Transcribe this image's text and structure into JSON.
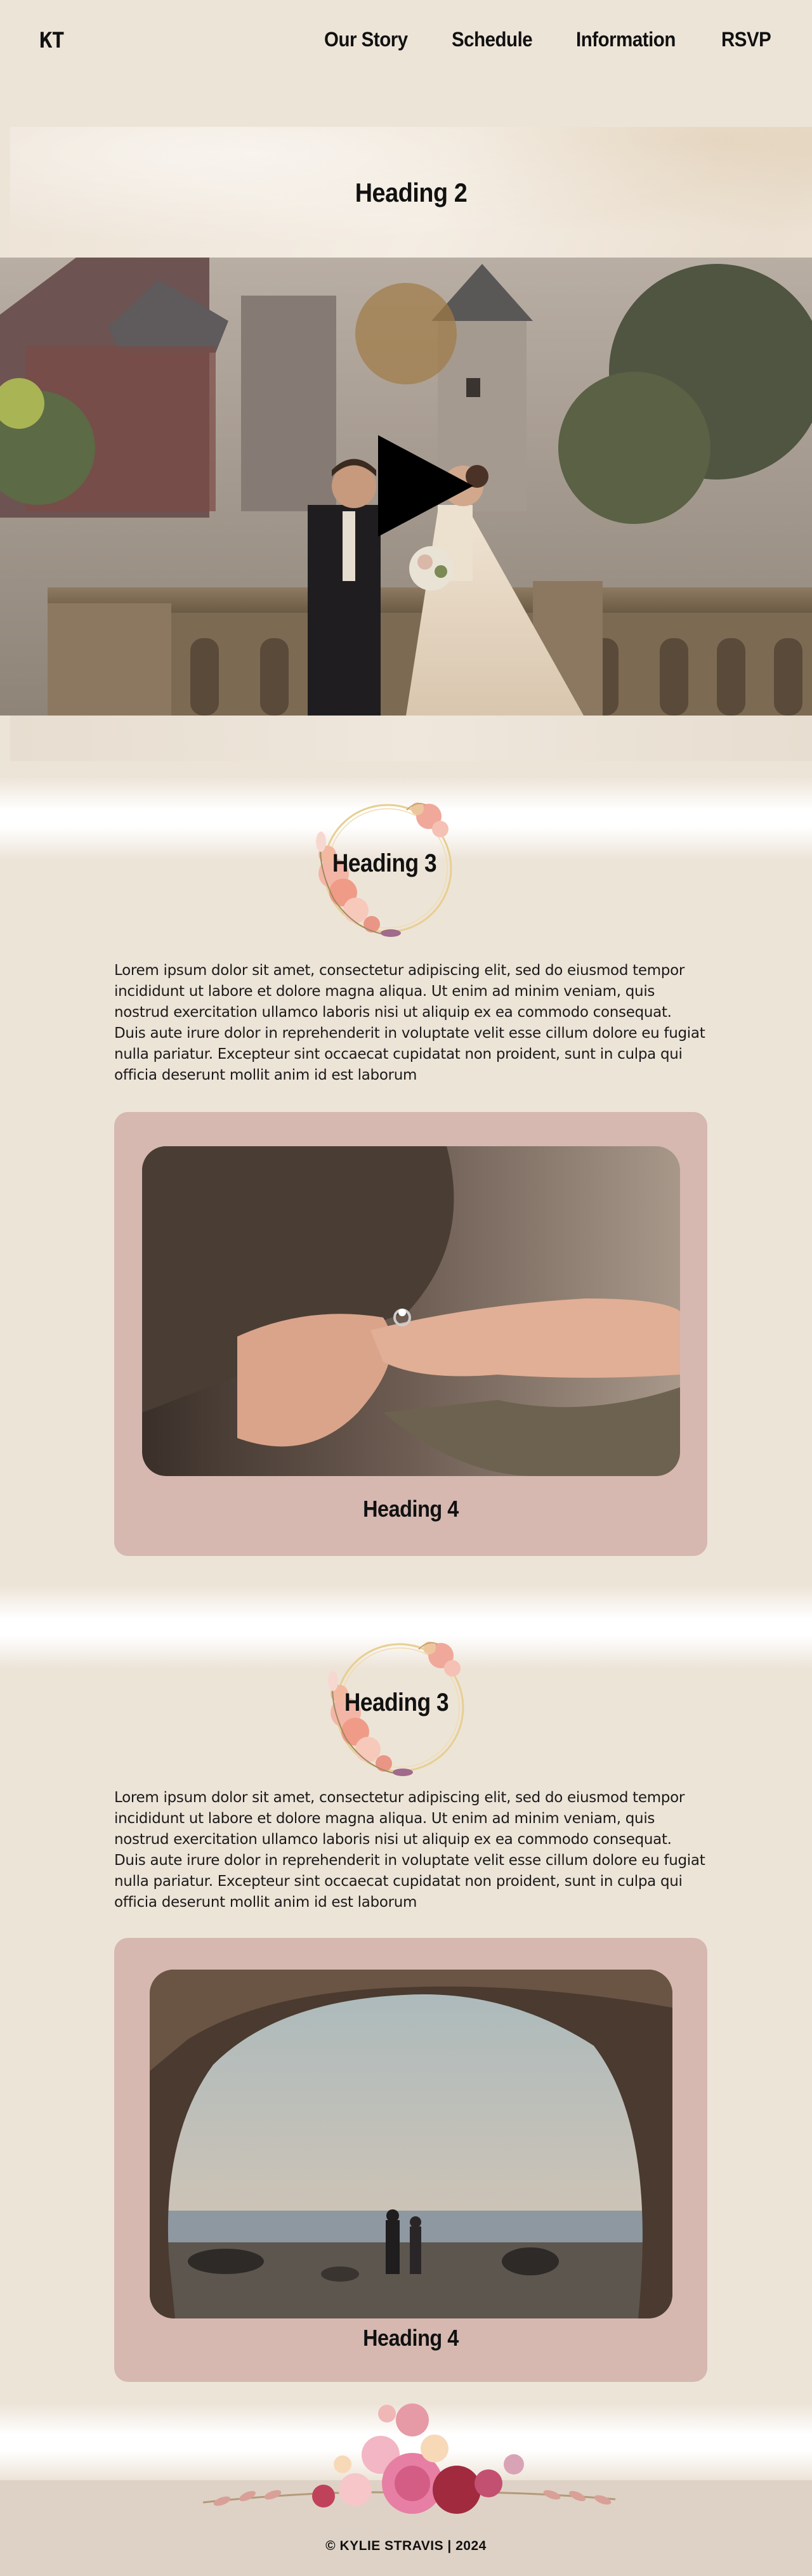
{
  "nav": {
    "logo": "KT",
    "links": [
      "Our Story",
      "Schedule",
      "Information",
      "RSVP"
    ]
  },
  "hero": {
    "heading": "Heading 2",
    "video_alt": "couple on castle balcony",
    "play_icon": "play-icon"
  },
  "sections": [
    {
      "heading": "Heading 3",
      "paragraph": "Lorem ipsum dolor sit amet, consectetur adipiscing elit, sed do eiusmod tempor incididunt ut labore et dolore magna aliqua. Ut enim ad minim veniam, quis nostrud exercitation ullamco laboris nisi ut aliquip ex ea commodo consequat. Duis aute irure dolor in reprehenderit in voluptate velit esse cillum dolore eu fugiat nulla pariatur. Excepteur sint occaecat cupidatat non proident, sunt in culpa qui officia deserunt mollit anim id est laborum",
      "card_heading": "Heading 4",
      "image": "engagement ring on hand"
    },
    {
      "heading": "Heading 3",
      "paragraph": "Lorem ipsum dolor sit amet, consectetur adipiscing elit, sed do eiusmod tempor incididunt ut labore et dolore magna aliqua. Ut enim ad minim veniam, quis nostrud exercitation ullamco laboris nisi ut aliquip ex ea commodo consequat. Duis aute irure dolor in reprehenderit in voluptate velit esse cillum dolore eu fugiat nulla pariatur. Excepteur sint occaecat cupidatat non proident, sunt in culpa qui officia deserunt mollit anim id est laborum",
      "card_heading": "Heading 4",
      "image": "couple in sea cave at sunset"
    }
  ],
  "footer": {
    "text": "© KYLIE STRAVIS | 2024"
  },
  "colors": {
    "background": "#ede4d8",
    "card": "#d6b8b0",
    "footer": "#ded2c6"
  }
}
